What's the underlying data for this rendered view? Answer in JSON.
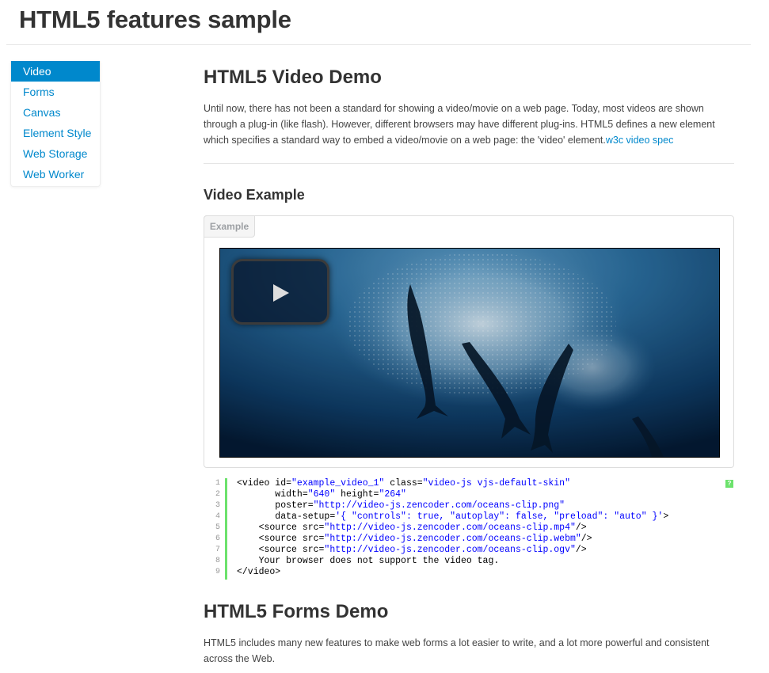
{
  "page": {
    "title": "HTML5 features sample"
  },
  "sidebar": {
    "items": [
      {
        "label": "Video"
      },
      {
        "label": "Forms"
      },
      {
        "label": "Canvas"
      },
      {
        "label": "Element Style"
      },
      {
        "label": "Web Storage"
      },
      {
        "label": "Web Worker"
      }
    ]
  },
  "video_section": {
    "heading": "HTML5 Video Demo",
    "intro": "Until now, there has not been a standard for showing a video/movie on a web page. Today, most videos are shown through a plug-in (like flash). However, different browsers may have different plug-ins. HTML5 defines a new element which specifies a standard way to embed a video/movie on a web page: the 'video' element.",
    "spec_link": "w3c video spec",
    "example_heading": "Video Example",
    "example_tab": "Example"
  },
  "code": {
    "line_numbers": [
      "1",
      "2",
      "3",
      "4",
      "5",
      "6",
      "7",
      "8",
      "9"
    ],
    "help_label": "?",
    "lines": [
      [
        {
          "t": "<video id=",
          "c": "p"
        },
        {
          "t": "\"example_video_1\"",
          "c": "s"
        },
        {
          "t": " class=",
          "c": "p"
        },
        {
          "t": "\"video-js vjs-default-skin\"",
          "c": "s"
        }
      ],
      [
        {
          "t": "       width=",
          "c": "p"
        },
        {
          "t": "\"640\"",
          "c": "s"
        },
        {
          "t": " height=",
          "c": "p"
        },
        {
          "t": "\"264\"",
          "c": "s"
        }
      ],
      [
        {
          "t": "       poster=",
          "c": "p"
        },
        {
          "t": "\"http://video-js.zencoder.com/oceans-clip.png\"",
          "c": "s"
        }
      ],
      [
        {
          "t": "       data-setup=",
          "c": "p"
        },
        {
          "t": "'{ \"controls\": true, \"autoplay\": false, \"preload\": \"auto\" }'",
          "c": "s"
        },
        {
          "t": ">",
          "c": "p"
        }
      ],
      [
        {
          "t": "    <source src=",
          "c": "p"
        },
        {
          "t": "\"http://video-js.zencoder.com/oceans-clip.mp4\"",
          "c": "s"
        },
        {
          "t": "/>",
          "c": "p"
        }
      ],
      [
        {
          "t": "    <source src=",
          "c": "p"
        },
        {
          "t": "\"http://video-js.zencoder.com/oceans-clip.webm\"",
          "c": "s"
        },
        {
          "t": "/>",
          "c": "p"
        }
      ],
      [
        {
          "t": "    <source src=",
          "c": "p"
        },
        {
          "t": "\"http://video-js.zencoder.com/oceans-clip.ogv\"",
          "c": "s"
        },
        {
          "t": "/>",
          "c": "p"
        }
      ],
      [
        {
          "t": "    Your browser does not support the video tag.",
          "c": "p"
        }
      ],
      [
        {
          "t": "</video>",
          "c": "p"
        }
      ]
    ]
  },
  "forms_section": {
    "heading": "HTML5 Forms Demo",
    "intro": "HTML5 includes many new features to make web forms a lot easier to write, and a lot more powerful and consistent across the Web."
  },
  "colors": {
    "accent": "#0088cc",
    "gutter_bar": "#6ce26c",
    "string": "#0000ff"
  }
}
